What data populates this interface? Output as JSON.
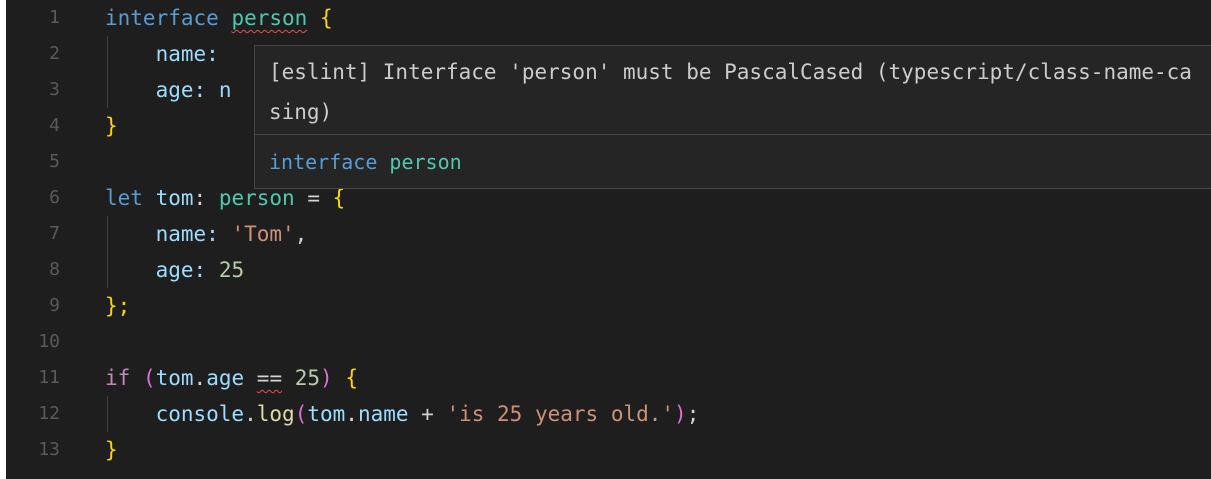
{
  "gutter": {
    "line_numbers": [
      "1",
      "2",
      "3",
      "4",
      "5",
      "6",
      "7",
      "8",
      "9",
      "10",
      "11",
      "12",
      "13"
    ]
  },
  "code": {
    "line1": {
      "kw": "interface",
      "name": "person",
      "open": "{"
    },
    "line2": {
      "prop": "name:"
    },
    "line3": {
      "prop": "age:",
      "partial": "n"
    },
    "line4": {
      "close": "}"
    },
    "line6": {
      "kw": "let",
      "var": "tom",
      "colon": ":",
      "type": "person",
      "eq": " = ",
      "open": "{"
    },
    "line7": {
      "prop": "name:",
      "str": "'Tom'",
      "comma": ","
    },
    "line8": {
      "prop": "age:",
      "num": "25"
    },
    "line9": {
      "close": "};"
    },
    "line11": {
      "kw": "if",
      "paren_open": "(",
      "obj": "tom",
      "dot": ".",
      "prop": "age",
      "op": "==",
      "num": "25",
      "paren_close": ")",
      "open": "{"
    },
    "line12": {
      "obj": "console",
      "dot": ".",
      "fn": "log",
      "paren_open": "(",
      "obj2": "tom",
      "dot2": ".",
      "prop": "name",
      "plus": " + ",
      "str": "'is 25 years old.'",
      "paren_close": ")",
      "semi": ";"
    },
    "line13": {
      "close": "}"
    }
  },
  "hover": {
    "message": "[eslint] Interface 'person' must be PascalCased (typescript/class-name-casing)",
    "signature_kw": "interface",
    "signature_name": "person"
  },
  "colors": {
    "background": "#1e1e1e",
    "keyword": "#569cd6",
    "control_keyword": "#c586c0",
    "type": "#4ec9b0",
    "variable": "#9cdcfe",
    "string": "#ce9178",
    "number": "#b5cea8",
    "function": "#dcdcaa",
    "bracket_gold": "#ffd700",
    "bracket_purple": "#da70d6",
    "error_squiggle": "#f14c4c",
    "hover_background": "#252526"
  }
}
